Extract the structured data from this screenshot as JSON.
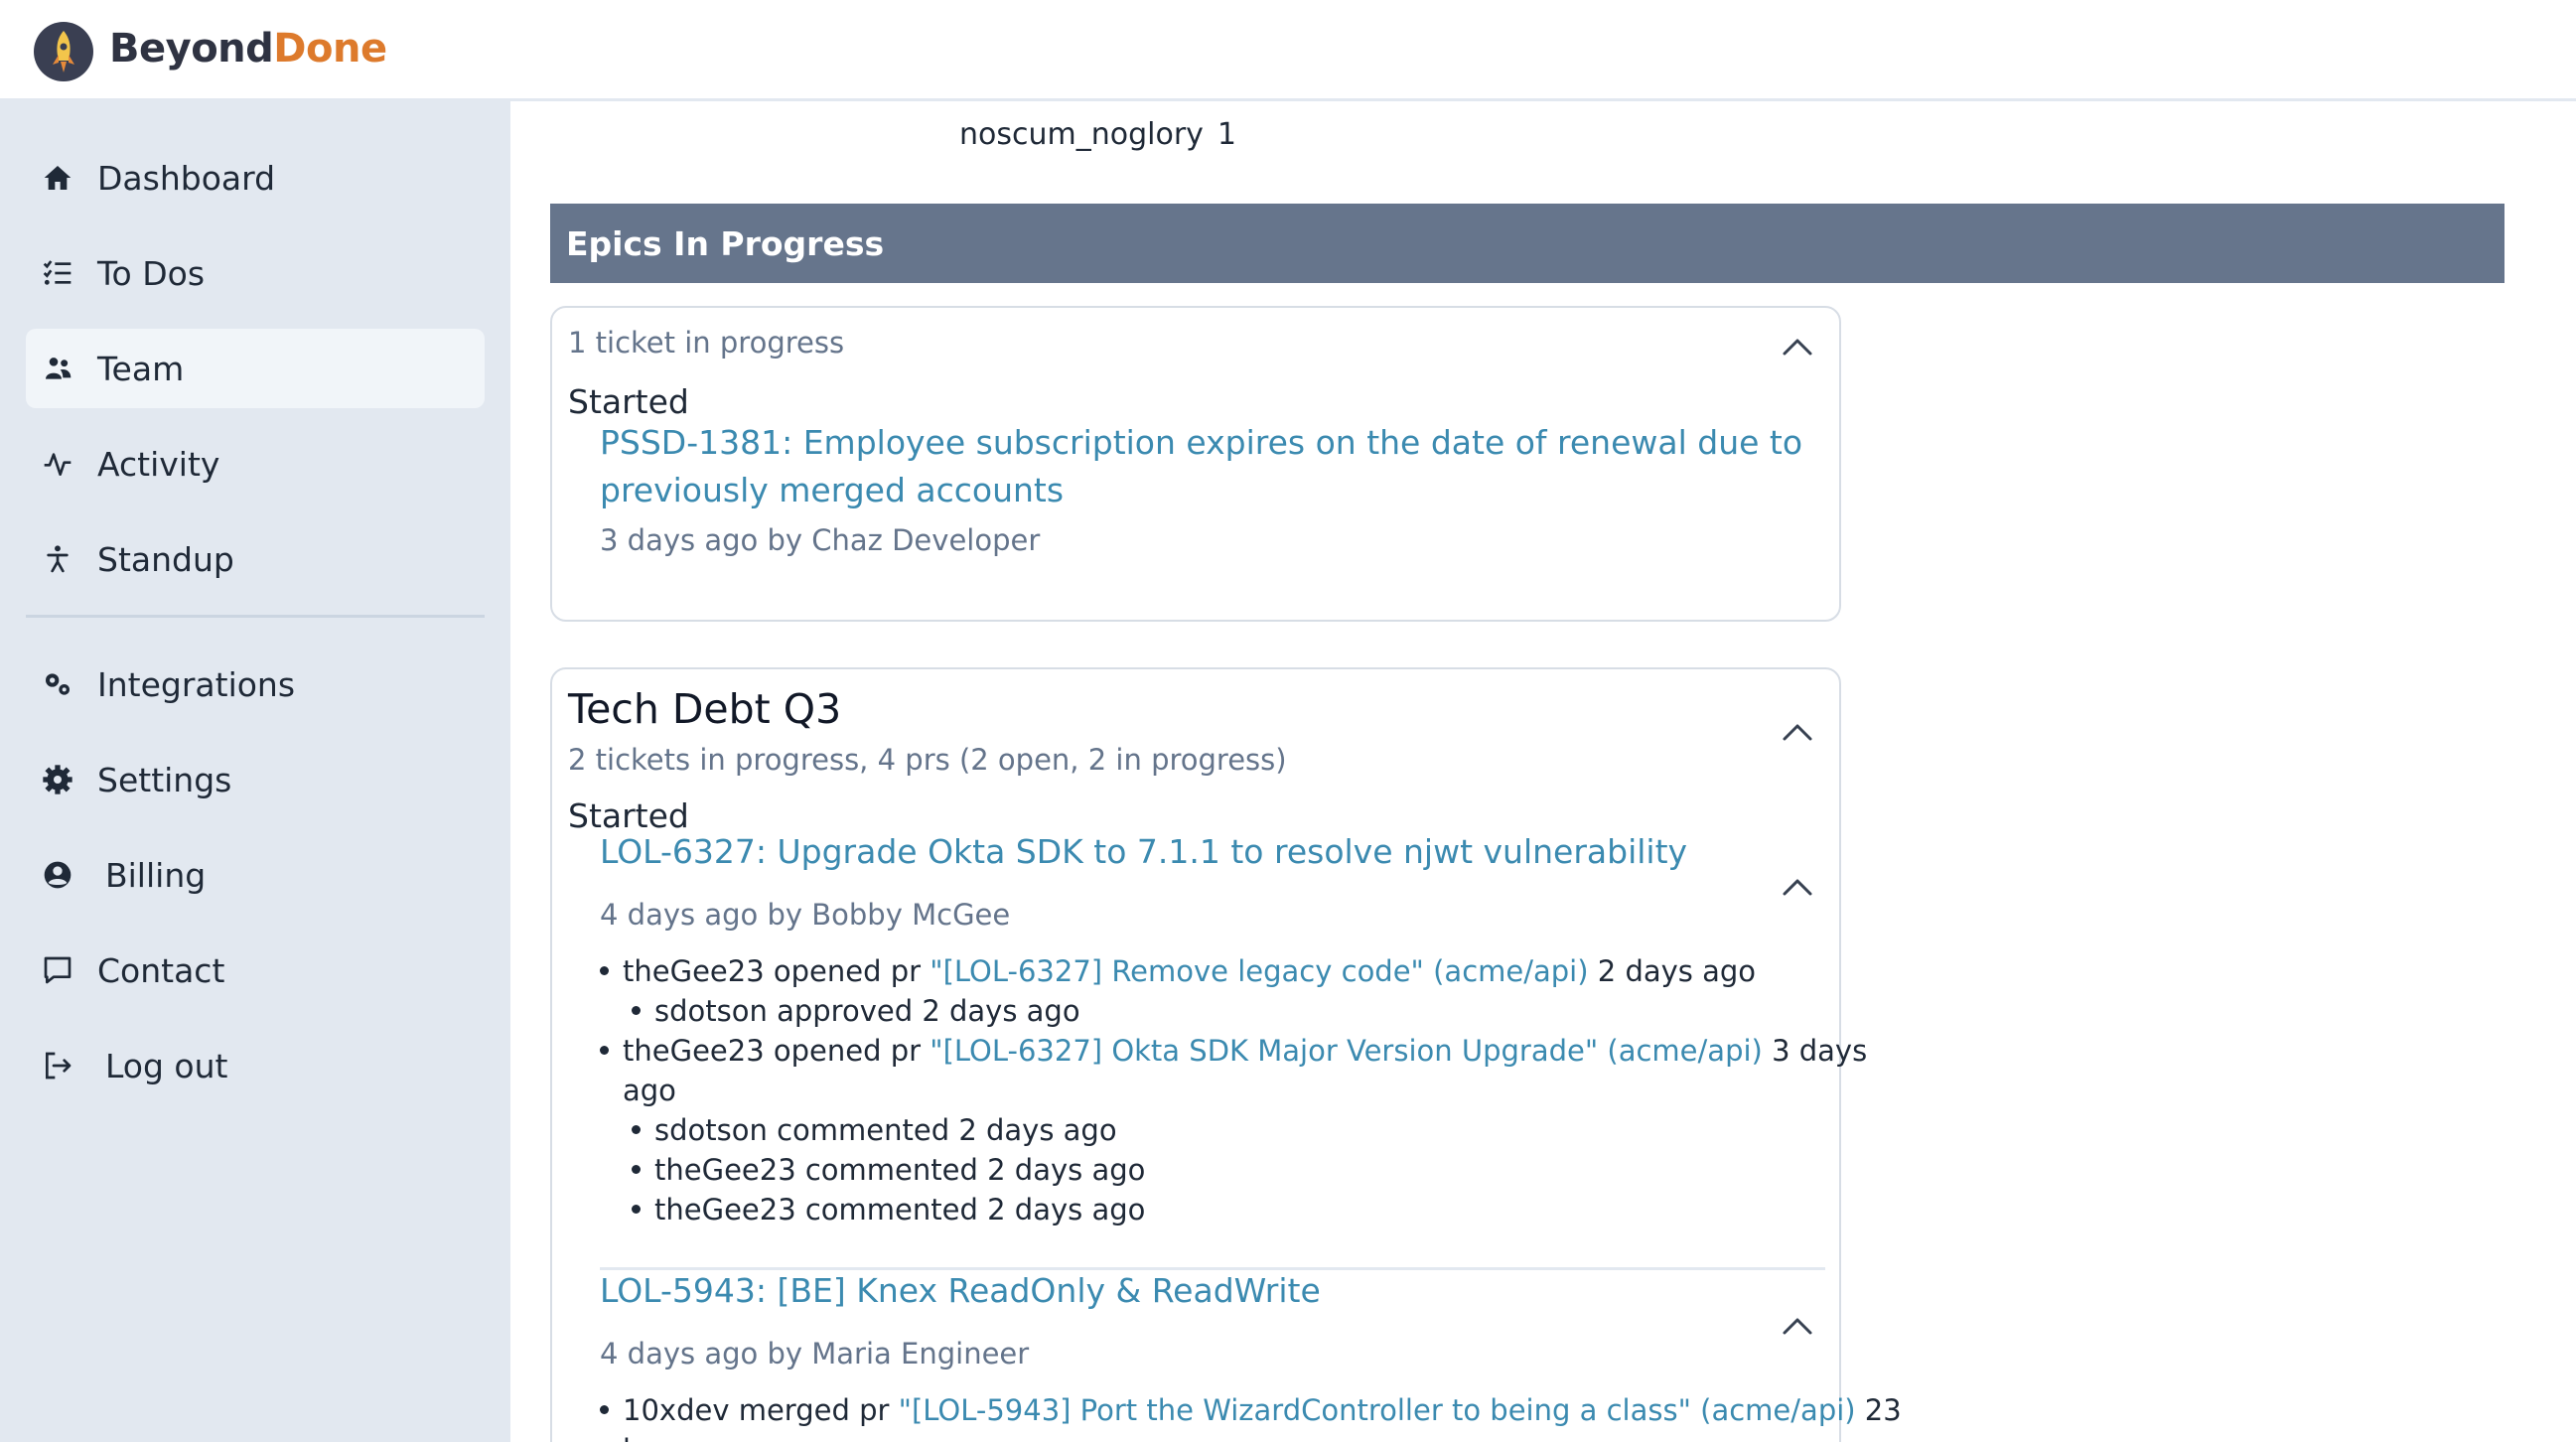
{
  "brand": {
    "part1": "Beyond",
    "part2": "Done",
    "accent": "#dd7a2c"
  },
  "sidebar": {
    "items": [
      {
        "label": "Dashboard",
        "icon": "home-icon"
      },
      {
        "label": "To Dos",
        "icon": "checklist-icon"
      },
      {
        "label": "Team",
        "icon": "team-icon",
        "active": true
      },
      {
        "label": "Activity",
        "icon": "activity-icon"
      },
      {
        "label": "Standup",
        "icon": "person-icon"
      },
      {
        "label": "Integrations",
        "icon": "gears-icon"
      },
      {
        "label": "Settings",
        "icon": "gear-icon"
      },
      {
        "label": "Billing",
        "icon": "user-circle-icon"
      },
      {
        "label": "Contact",
        "icon": "message-icon"
      },
      {
        "label": "Log out",
        "icon": "logout-icon"
      }
    ]
  },
  "main": {
    "team_row": {
      "user": "noscum_noglory",
      "count": "1"
    },
    "section_title": "Epics In Progress",
    "card1": {
      "summary": "1 ticket in progress",
      "status": "Started",
      "ticket": {
        "title_line1": "PSSD-1381: Employee subscription expires on the date of renewal due to",
        "title_line2": "previously merged accounts",
        "meta": "3 days ago by Chaz Developer"
      }
    },
    "card2": {
      "title": "Tech Debt Q3",
      "summary": "2 tickets in progress, 4 prs (2 open, 2 in progress)",
      "status": "Started",
      "ticket1": {
        "title": "LOL-6327: Upgrade Okta SDK to 7.1.1 to resolve njwt vulnerability",
        "meta": "4 days ago by Bobby McGee",
        "activity": [
          {
            "pre": "theGee23 opened pr ",
            "link": "\"[LOL-6327] Remove legacy code\" (acme/api)",
            "post": " 2 days ago"
          },
          {
            "text": "sdotson approved 2 days ago"
          },
          {
            "pre": "theGee23 opened pr ",
            "link": "\"[LOL-6327] Okta SDK Major Version Upgrade\" (acme/api)",
            "post": " 3 days",
            "post2": "ago"
          },
          {
            "text": "sdotson commented 2 days ago"
          },
          {
            "text": "theGee23 commented 2 days ago"
          },
          {
            "text": "theGee23 commented 2 days ago"
          }
        ]
      },
      "ticket2": {
        "title": "LOL-5943: [BE] Knex ReadOnly & ReadWrite",
        "meta": "4 days ago by Maria Engineer",
        "activity": [
          {
            "pre": "10xdev merged pr ",
            "link": "\"[LOL-5943] Port the WizardController to being a class\" (acme/api)",
            "post": " 23",
            "post2": "hours ago"
          }
        ]
      }
    }
  }
}
